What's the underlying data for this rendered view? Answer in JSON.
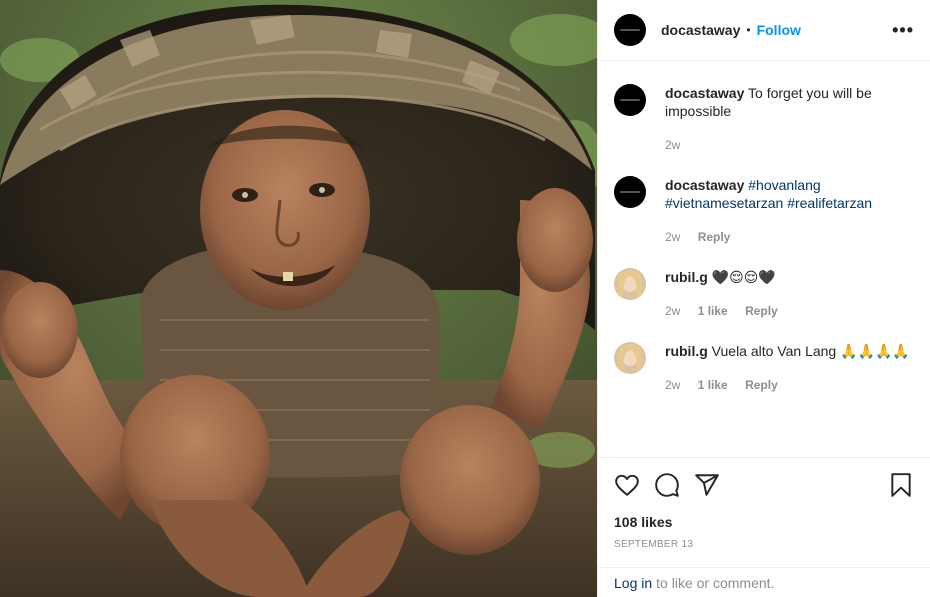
{
  "post": {
    "username": "docastaway",
    "separator": "•",
    "follow_label": "Follow",
    "more_label": "•••"
  },
  "comments": [
    {
      "username": "docastaway",
      "text": "To forget you will be impossible",
      "time": "2w",
      "likes": "",
      "reply": ""
    },
    {
      "username": "docastaway",
      "tags": [
        "#hovanlang",
        "#vietnamesetarzan",
        "#realifetarzan"
      ],
      "time": "2w",
      "reply": "Reply"
    },
    {
      "username": "rubil.g",
      "text": "🖤😌😌🖤",
      "time": "2w",
      "likes": "1 like",
      "reply": "Reply"
    },
    {
      "username": "rubil.g",
      "text": "Vuela alto Van Lang 🙏🙏🙏🙏",
      "time": "2w",
      "likes": "1 like",
      "reply": "Reply"
    }
  ],
  "actions": {
    "icons": [
      "heart-icon",
      "comment-icon",
      "share-icon",
      "bookmark-icon"
    ],
    "likes": "108 likes",
    "date": "SEPTEMBER 13"
  },
  "login": {
    "link": "Log in",
    "text": "to like or comment."
  },
  "colors": {
    "link_blue": "#0095f6",
    "hashtag": "#00376b",
    "muted": "#8e8e8e",
    "border": "#efefef"
  }
}
